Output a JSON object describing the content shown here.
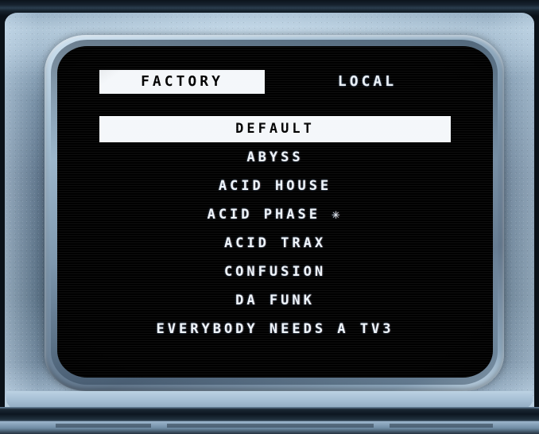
{
  "device": {
    "type": "crt-television",
    "bezel_color": "#7b94aa",
    "screen_color": "#000000"
  },
  "screen": {
    "tabs": [
      {
        "label": "FACTORY",
        "selected": true
      },
      {
        "label": "LOCAL",
        "selected": false
      }
    ],
    "preset_list": [
      {
        "label": "DEFAULT",
        "selected": true
      },
      {
        "label": "ABYSS",
        "selected": false
      },
      {
        "label": "ACID HOUSE",
        "selected": false
      },
      {
        "label": "ACID PHASE ✳",
        "selected": false
      },
      {
        "label": "ACID TRAX",
        "selected": false
      },
      {
        "label": "CONFUSION",
        "selected": false
      },
      {
        "label": "DA FUNK",
        "selected": false
      },
      {
        "label": "EVERYBODY NEEDS A TV3",
        "selected": false
      }
    ],
    "colors": {
      "text": "#eef4fa",
      "highlight_background": "#f4f7fa",
      "highlight_text": "#000000",
      "background": "#000000"
    }
  }
}
